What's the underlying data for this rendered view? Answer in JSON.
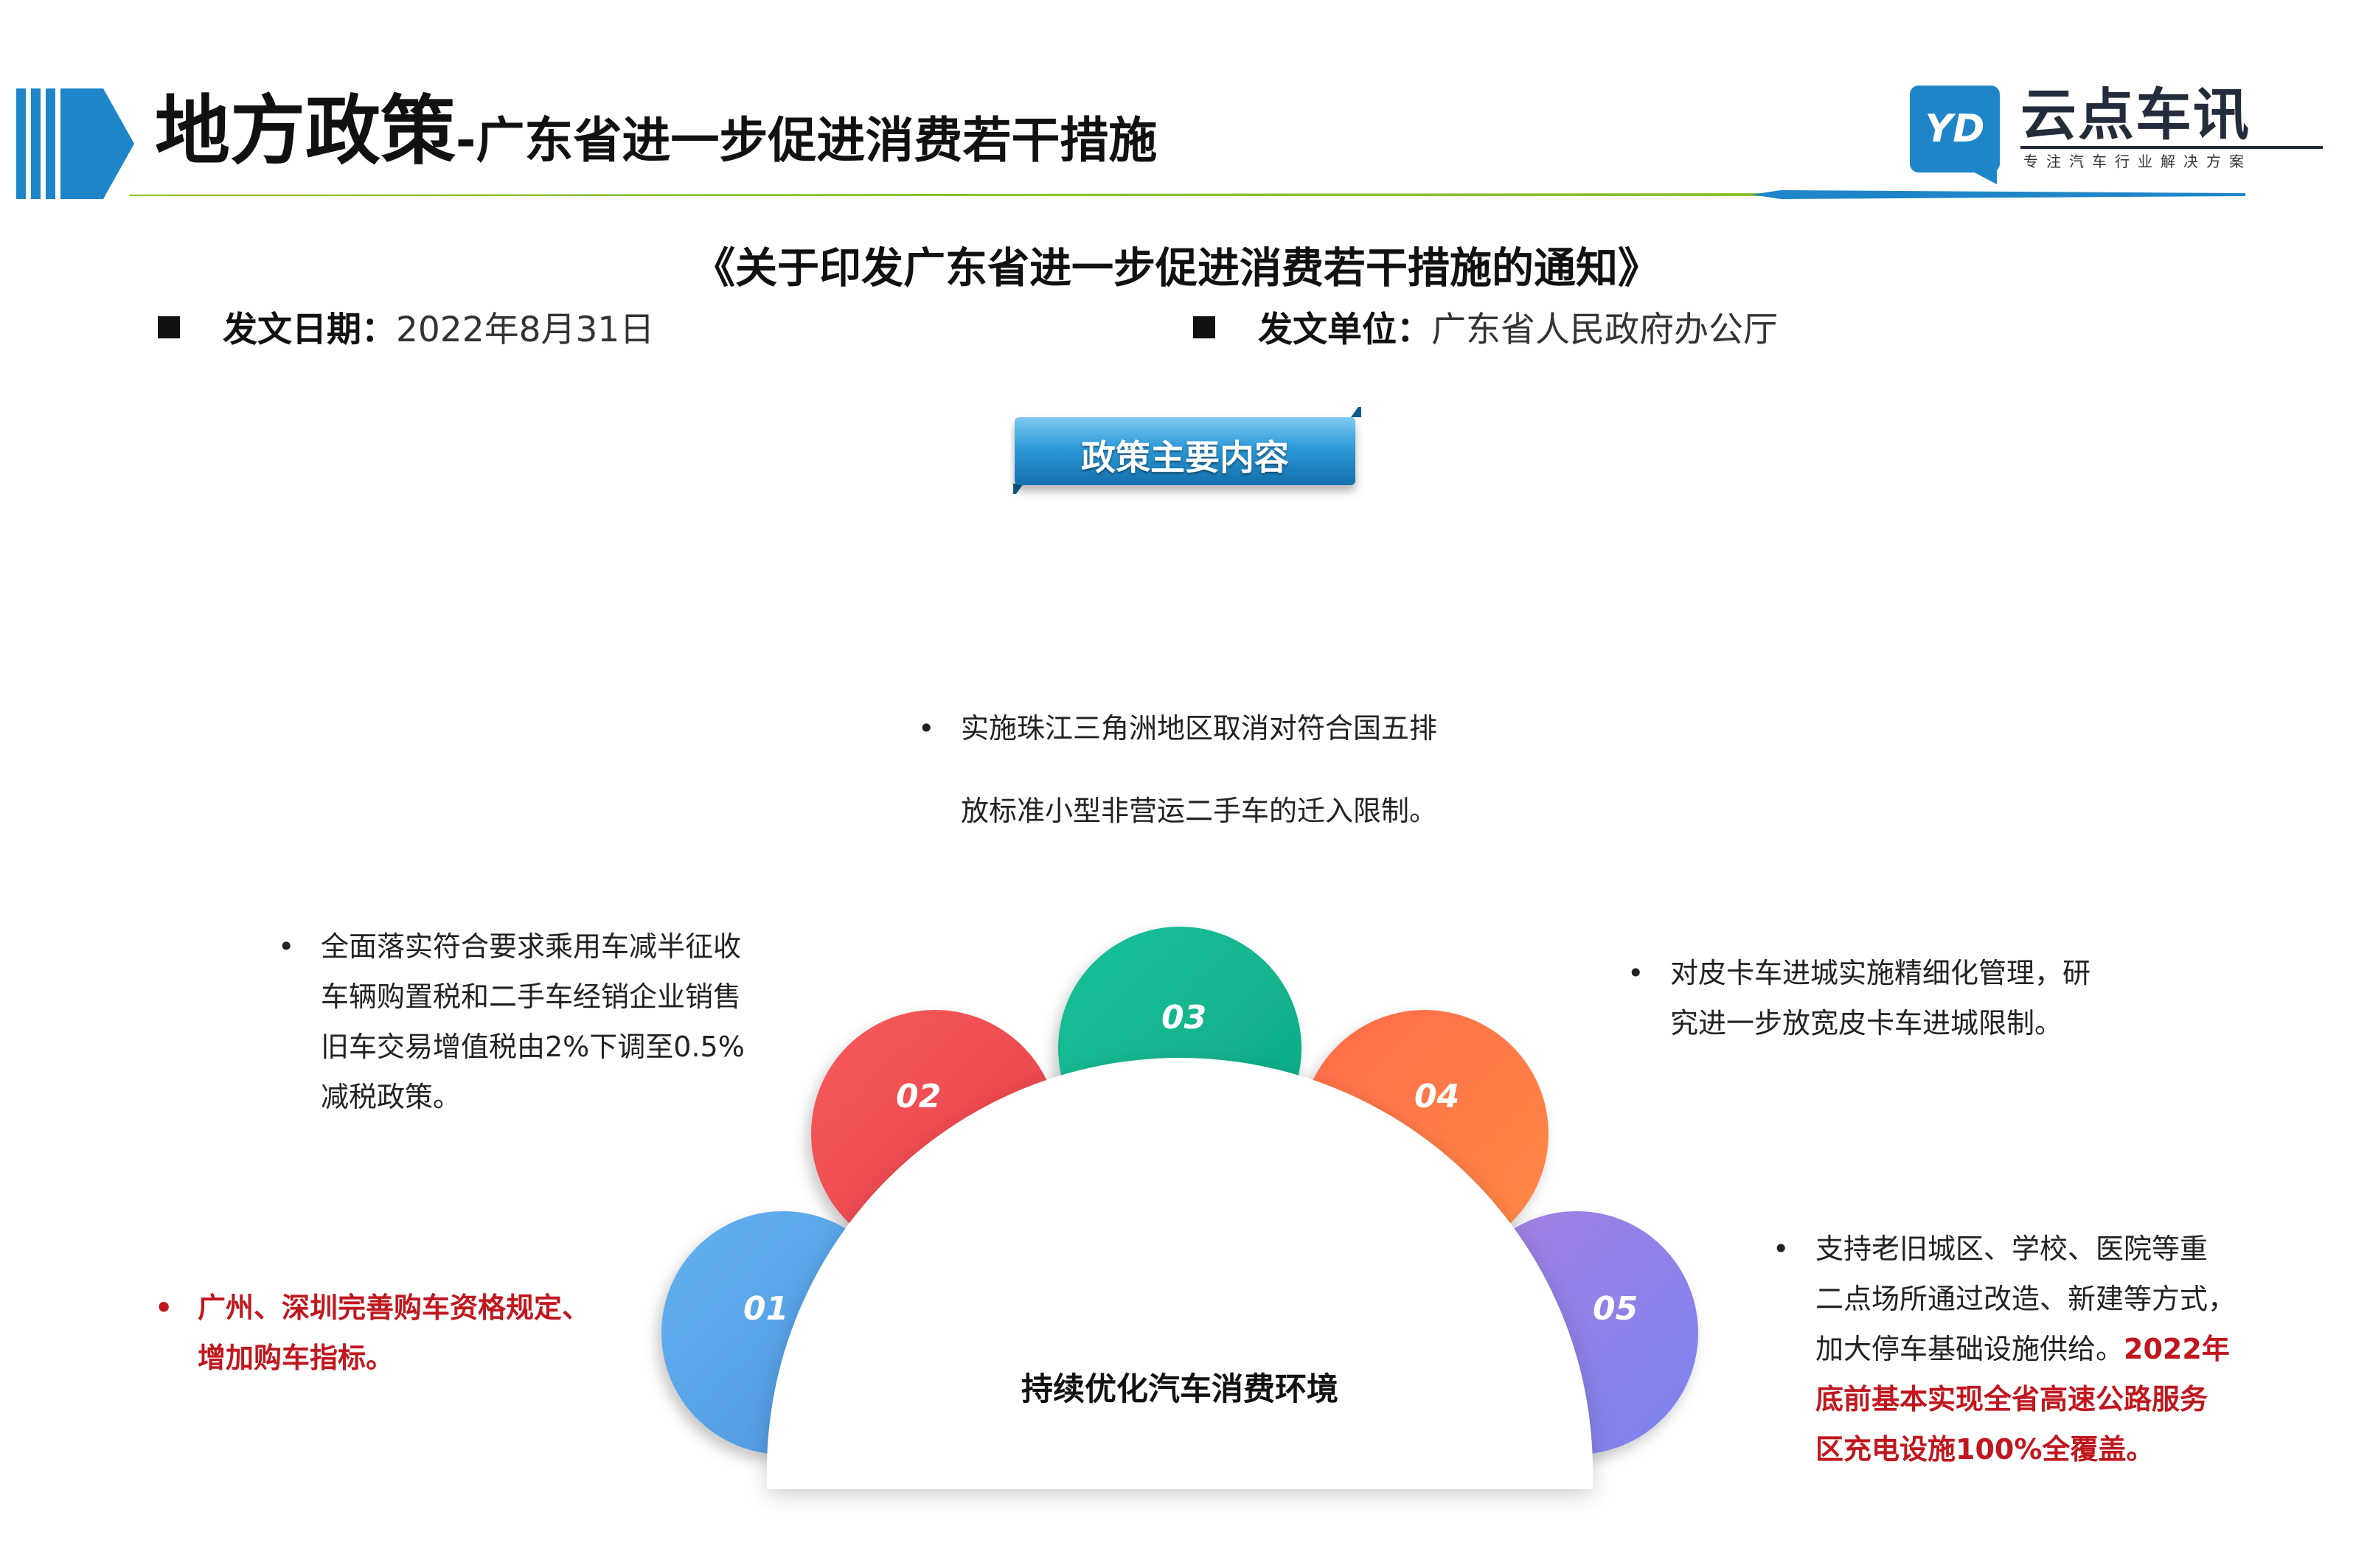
{
  "header": {
    "title_main": "地方政策",
    "title_sub": "-广东省进一步促进消费若干措施",
    "logo_name": "云点车讯",
    "logo_tag": "专注汽车行业解决方案",
    "logo_mark": "YD"
  },
  "notice": {
    "title": "《关于印发广东省进一步促进消费若干措施的通知》",
    "date_label": "发文日期：",
    "date_value": "2022年8月31日",
    "unit_label": "发文单位：",
    "unit_value": "广东省人民政府办公厅"
  },
  "content_button": "政策主要内容",
  "colors": {
    "accent_blue": "#1e86c8",
    "accent_green": "#8cbf2c",
    "petal_01": "#5aa6ea",
    "petal_02": "#f04c4f",
    "petal_03": "#12b690",
    "petal_04": "#ff7448",
    "petal_05": "#8e7de8",
    "highlight_red": "#c0171e"
  },
  "diagram": {
    "center_label": "持续优化汽车消费环境",
    "petals": [
      {
        "num": "01",
        "color": "#5aa6ea"
      },
      {
        "num": "02",
        "color": "#f04c4f"
      },
      {
        "num": "03",
        "color": "#12b690"
      },
      {
        "num": "04",
        "color": "#ff7448"
      },
      {
        "num": "05",
        "color": "#8e7de8"
      }
    ]
  },
  "items": {
    "top": {
      "bullet": "•",
      "lines": [
        "实施珠江三角洲地区取消对符合国五排",
        "放标准小型非营运二手车的迁入限制。"
      ]
    },
    "left": {
      "bullet": "•",
      "lines": [
        "全面落实符合要求乘用车减半征收",
        "车辆购置税和二手车经销企业销售",
        "旧车交易增值税由2%下调至0.5%",
        "减税政策。"
      ]
    },
    "right": {
      "bullet": "•",
      "lines": [
        "对皮卡车进城实施精细化管理，研",
        "究进一步放宽皮卡车进城限制。"
      ]
    },
    "right_bottom": {
      "bullet": "•",
      "line1": "支持老旧城区、学校、医院等重",
      "line2": "二点场所通过改造、新建等方式，",
      "line3_plain": "加大停车基础设施供给。",
      "line3_red": "2022年",
      "line4_red": "底前基本实现全省高速公路服务",
      "line5_red": "区充电设施100%全覆盖。"
    },
    "left_bottom": {
      "bullet": "•",
      "lines": [
        "广州、深圳完善购车资格规定、",
        "增加购车指标。"
      ]
    }
  }
}
